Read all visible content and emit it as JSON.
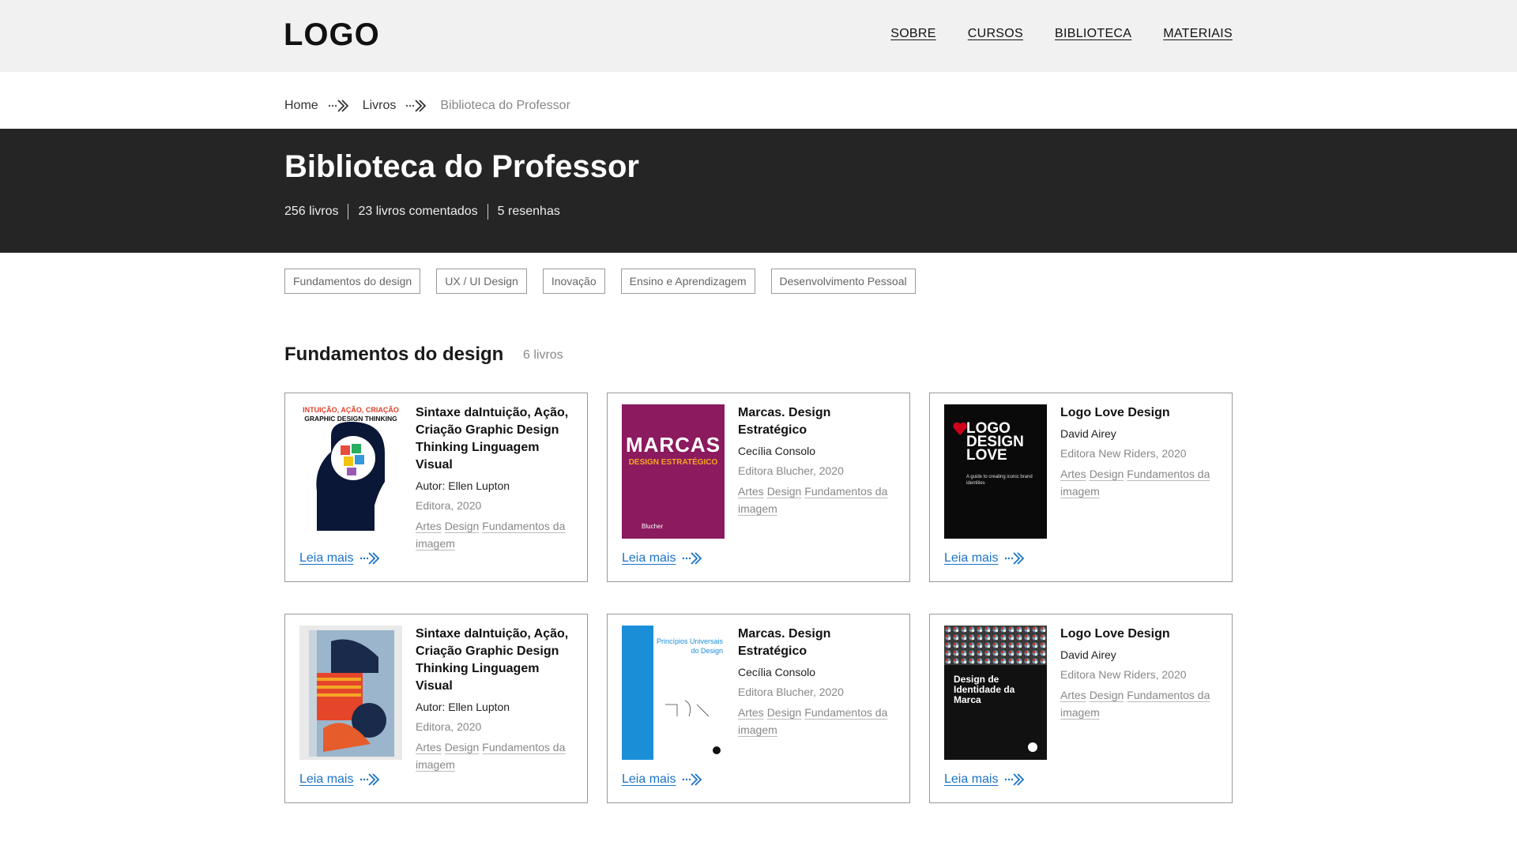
{
  "header": {
    "logo": "LOGO",
    "nav": [
      "SOBRE",
      "CURSOS",
      "BIBLIOTECA",
      "MATERIAIS"
    ]
  },
  "breadcrumb": [
    "Home",
    "Livros",
    "Biblioteca do Professor"
  ],
  "hero": {
    "title": "Biblioteca do Professor",
    "stats": [
      "256 livros",
      "23 livros comentados",
      "5 resenhas"
    ]
  },
  "tags": [
    "Fundamentos do design",
    "UX / UI Design",
    "Inovação",
    "Ensino e Aprendizagem",
    "Desenvolvimento Pessoal"
  ],
  "section": {
    "title": "Fundamentos do design",
    "count": "6 livros"
  },
  "more_label": "Leia mais",
  "books": [
    {
      "title": "Sintaxe daIntuição, Ação, Criação Graphic Design Thinking Linguagem Visual",
      "author": "Autor: Ellen Lupton",
      "publisher": "Editora, 2020",
      "categories": [
        "Artes",
        "Design",
        "Fundamentos da imagem"
      ],
      "cover_text": [
        "INTUIÇÃO, AÇÃO, CRIAÇÃO",
        "GRAPHIC DESIGN THINKING"
      ],
      "cover_color": "#ffffff"
    },
    {
      "title": "Marcas. Design Estratégico",
      "author": "Cecília Consolo",
      "publisher": "Editora Blucher, 2020",
      "categories": [
        "Artes",
        "Design",
        "Fundamentos da imagem"
      ],
      "cover_text": [
        "MARCAS",
        "DESIGN ESTRATÉGICO",
        "Blucher"
      ],
      "cover_color": "#8b1a5e"
    },
    {
      "title": "Logo Love Design",
      "author": "David Airey",
      "publisher": "Editora New Riders, 2020",
      "categories": [
        "Artes",
        "Design",
        "Fundamentos da imagem"
      ],
      "cover_text": [
        "LOGO",
        "DESIGN",
        "LOVE",
        "A guide to creating iconic brand identities"
      ],
      "cover_color": "#0a0a0a"
    },
    {
      "title": "Sintaxe daIntuição, Ação, Criação Graphic Design Thinking Linguagem Visual",
      "author": "Autor: Ellen Lupton",
      "publisher": "Editora, 2020",
      "categories": [
        "Artes",
        "Design",
        "Fundamentos da imagem"
      ],
      "cover_text": [],
      "cover_color": "#e9e9e9"
    },
    {
      "title": "Marcas. Design Estratégico",
      "author": "Cecília Consolo",
      "publisher": "Editora Blucher, 2020",
      "categories": [
        "Artes",
        "Design",
        "Fundamentos da imagem"
      ],
      "cover_text": [
        "Princípios Universais do Design"
      ],
      "cover_color": "#ffffff"
    },
    {
      "title": "Logo Love Design",
      "author": "David Airey",
      "publisher": "Editora New Riders, 2020",
      "categories": [
        "Artes",
        "Design",
        "Fundamentos da imagem"
      ],
      "cover_text": [
        "Design de Identidade da Marca"
      ],
      "cover_color": "#111111"
    }
  ]
}
